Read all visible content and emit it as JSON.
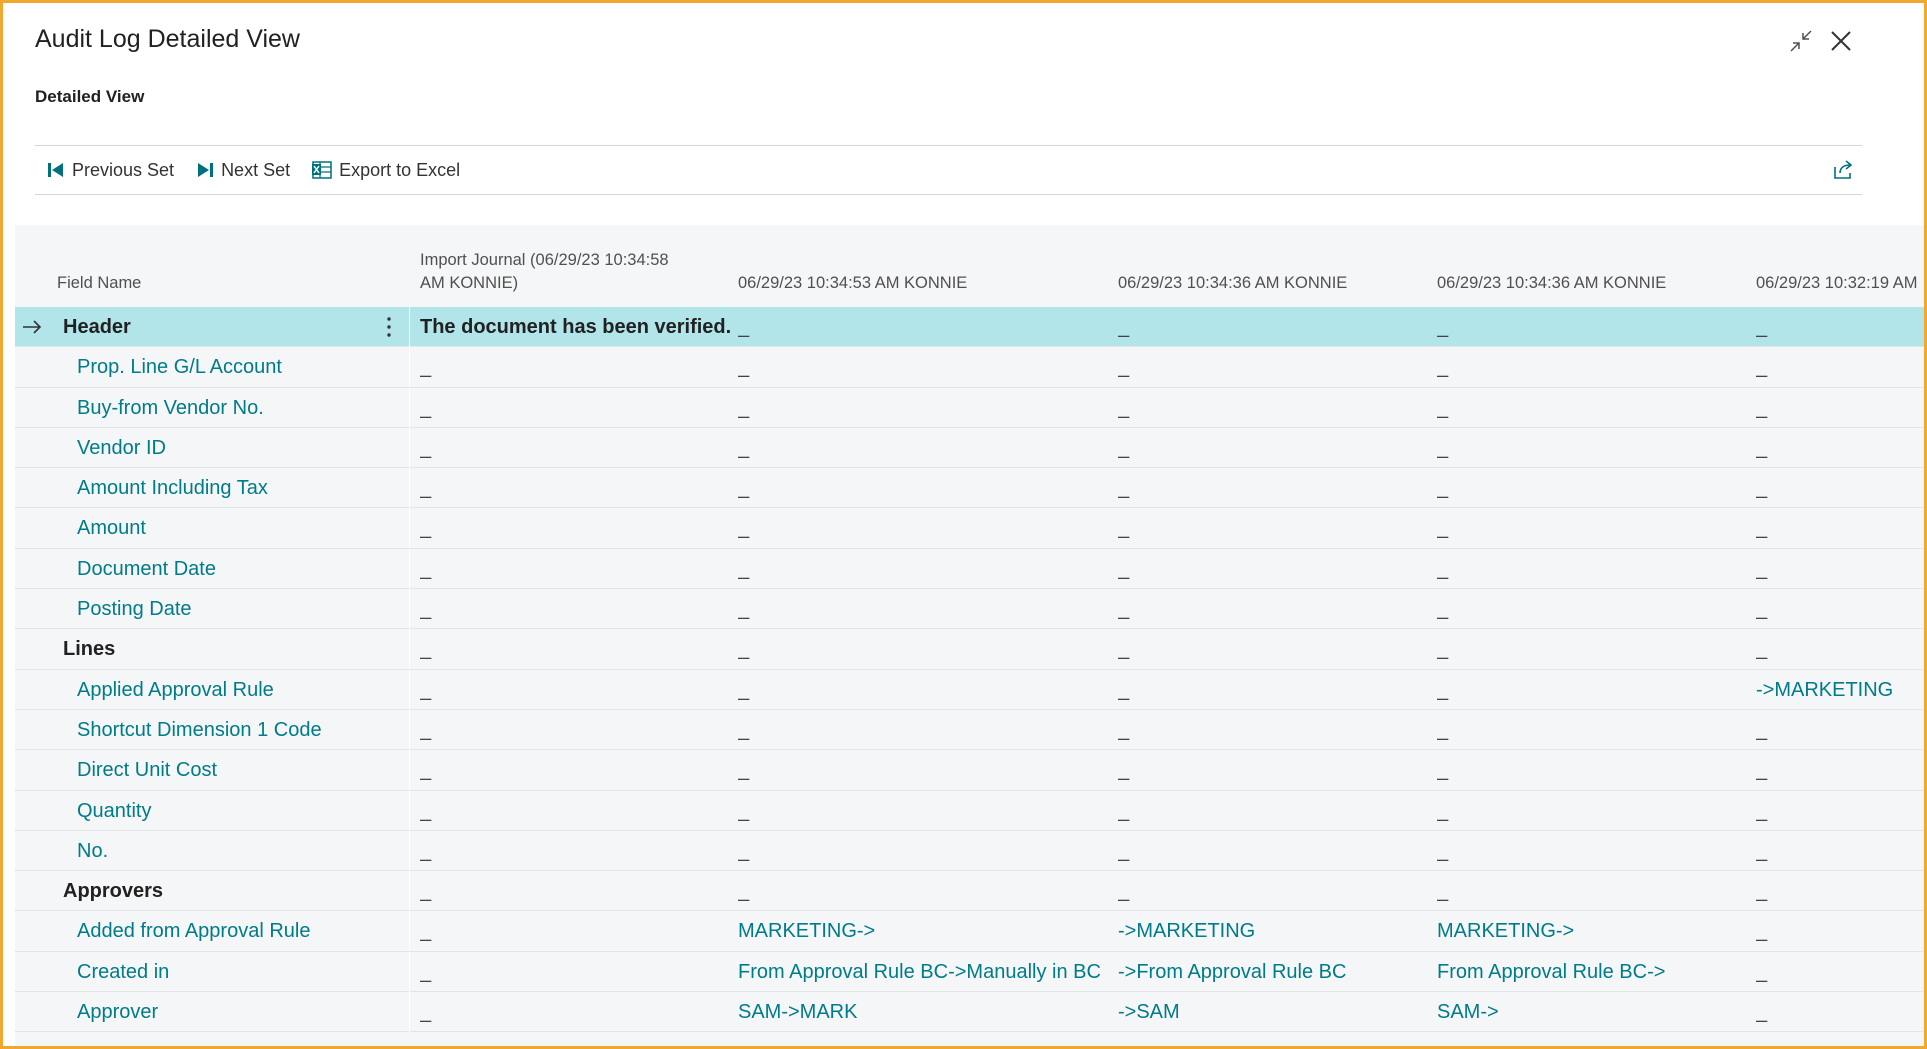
{
  "dialog": {
    "title": "Audit Log Detailed View",
    "subtitle": "Detailed View"
  },
  "toolbar": {
    "previous_label": "Previous Set",
    "next_label": "Next Set",
    "export_label": "Export to Excel"
  },
  "columns": [
    {
      "label": "Field Name"
    },
    {
      "label": "Import Journal (06/29/23 10:34:58",
      "label2": "AM KONNIE)"
    },
    {
      "label": "06/29/23 10:34:53 AM KONNIE"
    },
    {
      "label": "06/29/23 10:34:36 AM KONNIE"
    },
    {
      "label": "06/29/23 10:34:36 AM KONNIE"
    },
    {
      "label": "06/29/23 10:32:19 AM"
    }
  ],
  "rows": [
    {
      "name": "Header",
      "type": "group",
      "selected": true,
      "values": [
        "The document has been verified.",
        "_",
        "_",
        "_",
        "_"
      ]
    },
    {
      "name": "Prop. Line G/L Account",
      "type": "field",
      "values": [
        "_",
        "_",
        "_",
        "_",
        "_"
      ]
    },
    {
      "name": "Buy-from Vendor No.",
      "type": "field",
      "values": [
        "_",
        "_",
        "_",
        "_",
        "_"
      ]
    },
    {
      "name": "Vendor ID",
      "type": "field",
      "values": [
        "_",
        "_",
        "_",
        "_",
        "_"
      ]
    },
    {
      "name": "Amount Including Tax",
      "type": "field",
      "values": [
        "_",
        "_",
        "_",
        "_",
        "_"
      ]
    },
    {
      "name": "Amount",
      "type": "field",
      "values": [
        "_",
        "_",
        "_",
        "_",
        "_"
      ]
    },
    {
      "name": "Document Date",
      "type": "field",
      "values": [
        "_",
        "_",
        "_",
        "_",
        "_"
      ]
    },
    {
      "name": "Posting Date",
      "type": "field",
      "values": [
        "_",
        "_",
        "_",
        "_",
        "_"
      ]
    },
    {
      "name": "Lines",
      "type": "group",
      "values": [
        "_",
        "_",
        "_",
        "_",
        "_"
      ]
    },
    {
      "name": "Applied Approval Rule",
      "type": "field",
      "values": [
        "_",
        "_",
        "_",
        "_",
        "->MARKETING"
      ]
    },
    {
      "name": "Shortcut Dimension 1 Code",
      "type": "field",
      "values": [
        "_",
        "_",
        "_",
        "_",
        "_"
      ]
    },
    {
      "name": "Direct Unit Cost",
      "type": "field",
      "values": [
        "_",
        "_",
        "_",
        "_",
        "_"
      ]
    },
    {
      "name": "Quantity",
      "type": "field",
      "values": [
        "_",
        "_",
        "_",
        "_",
        "_"
      ]
    },
    {
      "name": "No.",
      "type": "field",
      "values": [
        "_",
        "_",
        "_",
        "_",
        "_"
      ]
    },
    {
      "name": "Approvers",
      "type": "group",
      "values": [
        "_",
        "_",
        "_",
        "_",
        "_"
      ]
    },
    {
      "name": "Added from Approval Rule",
      "type": "field",
      "values": [
        "_",
        "MARKETING->",
        "->MARKETING",
        "MARKETING->",
        "_"
      ]
    },
    {
      "name": "Created in",
      "type": "field",
      "values": [
        "_",
        "From Approval Rule BC->Manually in BC",
        "->From Approval Rule BC",
        "From Approval Rule BC->",
        "_"
      ]
    },
    {
      "name": "Approver",
      "type": "field",
      "values": [
        "_",
        "SAM->MARK",
        "->SAM",
        "SAM->",
        "_"
      ]
    }
  ],
  "colors": {
    "accent": "#007b88",
    "selected_row": "#b1e5ea",
    "frame_border": "#f0a830",
    "grid_background": "#f5f6f7"
  },
  "icons": {
    "previous": "previous-set-icon",
    "next": "next-set-icon",
    "export": "excel-icon",
    "share": "share-icon",
    "collapse": "collapse-icon",
    "close": "close-icon",
    "row_indicator": "arrow-right-icon",
    "row_menu": "more-vertical-icon"
  }
}
